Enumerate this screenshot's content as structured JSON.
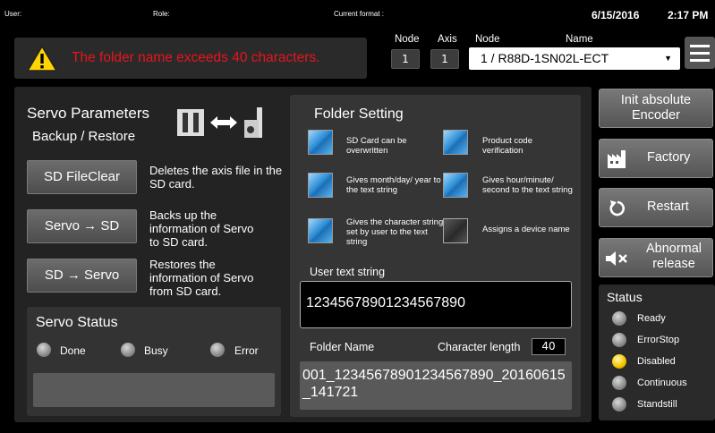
{
  "topbar": {
    "user_label": "User:",
    "role_label": "Role:",
    "format_label": "Current format :",
    "date": "6/15/2016",
    "time": "2:17 PM"
  },
  "alarm": {
    "message": "The folder name exceeds 40 characters."
  },
  "header": {
    "node_label": "Node",
    "axis_label": "Axis",
    "node_label2": "Node",
    "name_label": "Name",
    "node_value": "1",
    "axis_value": "1",
    "node_select": "1  /  R88D-1SN02L-ECT",
    "dropdown_arrow": "▼"
  },
  "servo": {
    "title": "Servo Parameters",
    "subtitle": "Backup / Restore",
    "buttons": [
      {
        "label": "SD FileClear",
        "desc": "Deletes the axis file in the SD card."
      },
      {
        "label": "Servo → SD",
        "desc": "Backs up the information of Servo to SD card."
      },
      {
        "label": "SD → Servo",
        "desc": "Restores the information of Servo from SD card."
      }
    ]
  },
  "servo_status": {
    "title": "Servo Status",
    "lamps": [
      "Done",
      "Busy",
      "Error"
    ]
  },
  "folder": {
    "title": "Folder Setting",
    "options": [
      {
        "label": "SD Card can be overwritten",
        "checked": true
      },
      {
        "label": "Product code verification",
        "checked": true
      },
      {
        "label": "Gives month/day/ year to the text string",
        "checked": true
      },
      {
        "label": "Gives hour/minute/ second to the text string",
        "checked": true
      },
      {
        "label": "Gives the character string set by user to the text string",
        "checked": true
      },
      {
        "label": "Assigns a device name",
        "checked": false
      }
    ],
    "user_text_label": "User text string",
    "user_text_value": "12345678901234567890",
    "folder_name_label": "Folder Name",
    "char_length_label": "Character length",
    "char_length_value": "40",
    "folder_name_value": "001_12345678901234567890_20160615_141721"
  },
  "right": {
    "init_label": "Init absolute Encoder",
    "factory_label": "Factory",
    "restart_label": "Restart",
    "abnormal_label": "Abnormal release"
  },
  "status": {
    "title": "Status",
    "items": [
      {
        "label": "Ready",
        "on": false
      },
      {
        "label": "ErrorStop",
        "on": false
      },
      {
        "label": "Disabled",
        "on": true
      },
      {
        "label": "Continuous",
        "on": false
      },
      {
        "label": "Standstill",
        "on": false
      }
    ]
  },
  "colors": {
    "alarm_text": "#e8141e",
    "checkbox_on": "#2f8fd6",
    "lamp_on": "#f6c600"
  }
}
